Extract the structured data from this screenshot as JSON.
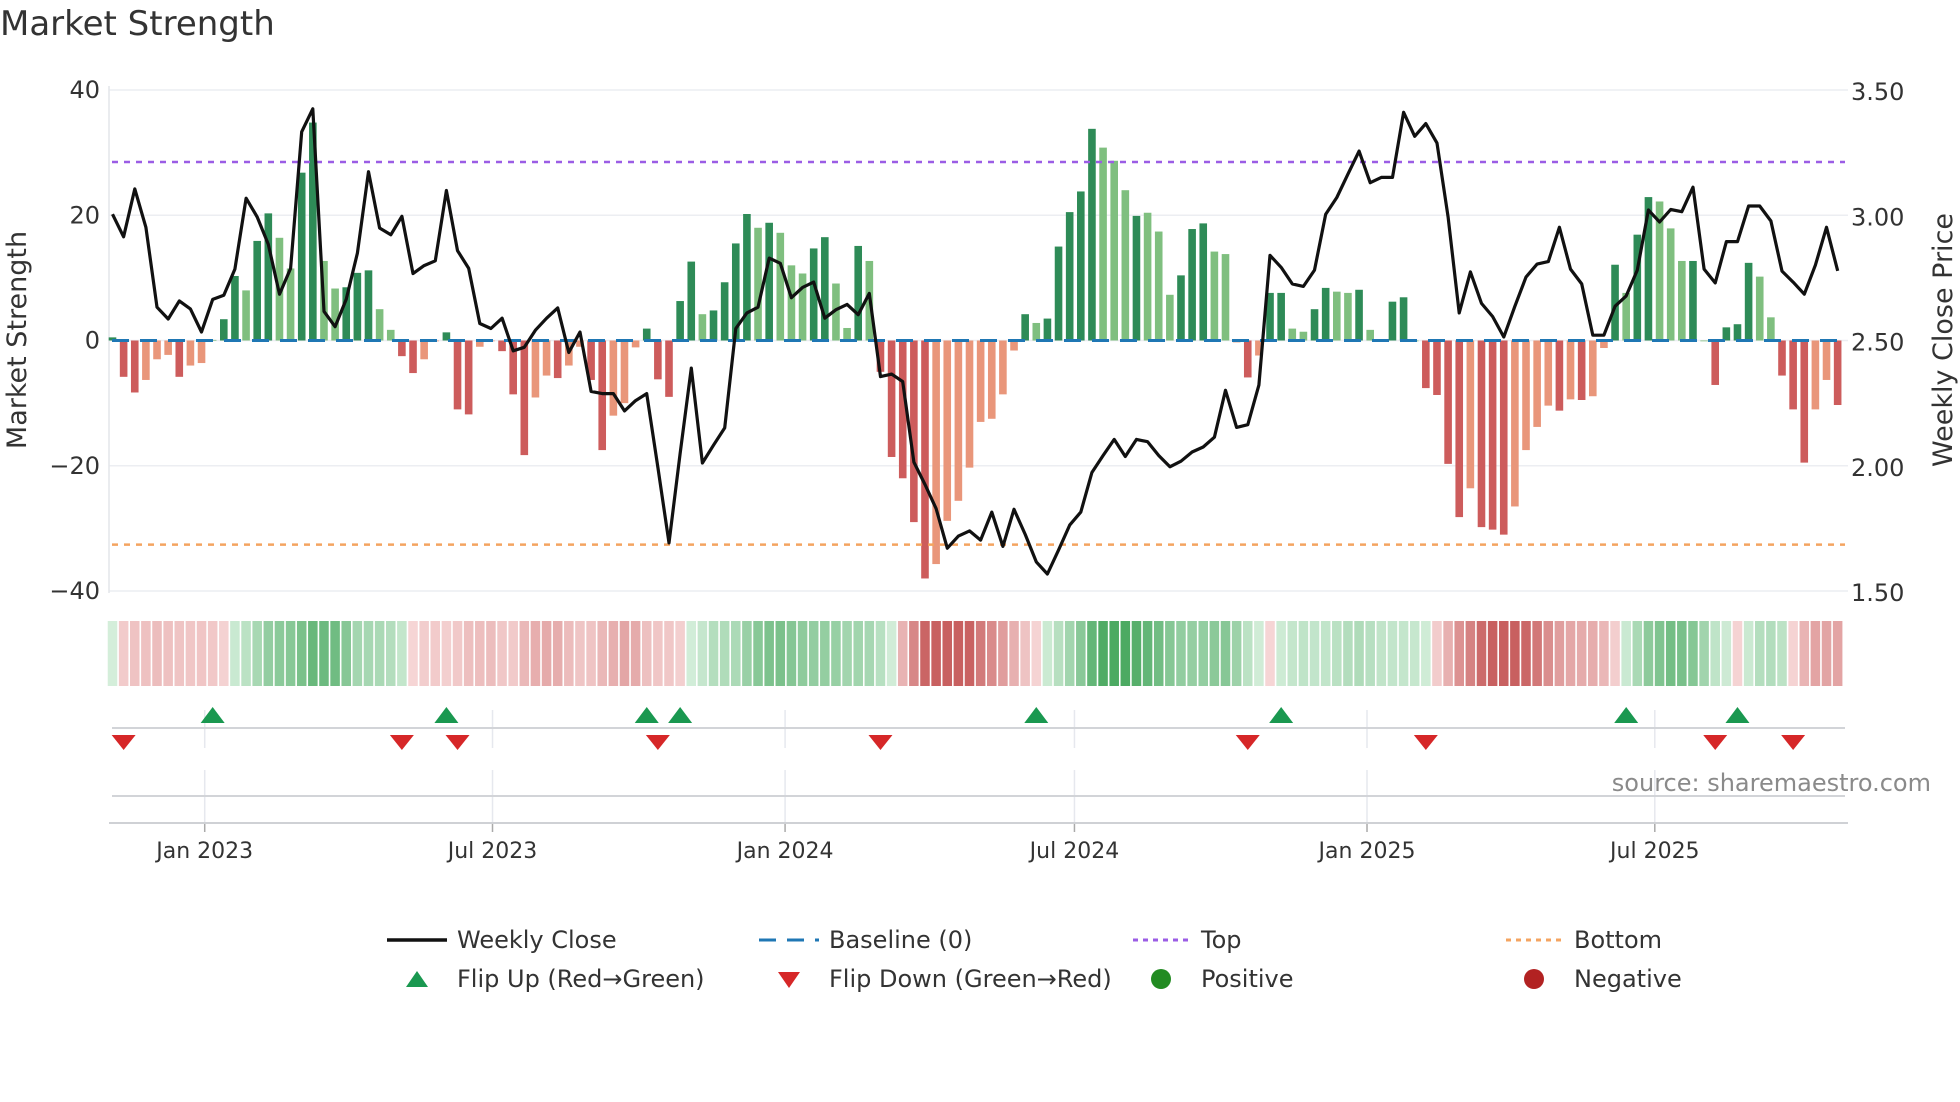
{
  "title": "Market Strength",
  "source": "source: sharemaestro.com",
  "legend": {
    "weekly_close": "Weekly Close",
    "baseline": "Baseline (0)",
    "top": "Top",
    "bottom": "Bottom",
    "flip_up": "Flip Up (Red→Green)",
    "flip_down": "Flip Down (Green→Red)",
    "positive": "Positive",
    "negative": "Negative"
  },
  "colors": {
    "strong_up": "#2e8b57",
    "weak_up": "#7fbf7f",
    "strong_down": "#cd5c5c",
    "weak_down": "#e9967a",
    "close_line": "#111111",
    "baseline": "#1f77b4",
    "top": "#9b5de5",
    "bottom": "#f4a460",
    "flip_up": "#1a9850",
    "flip_down": "#d62728",
    "positive": "#228b22",
    "negative": "#b22222"
  },
  "chart_data": {
    "type": "bar",
    "title": "Market Strength",
    "ylabel": "Market Strength",
    "ylabel_right": "Weekly Close Price",
    "ylim": [
      -40,
      40
    ],
    "ylim_right": [
      1.5,
      3.5
    ],
    "yticks": [
      "40",
      "20",
      "0",
      "−20",
      "−40"
    ],
    "yticks_right": [
      "3.50",
      "3.00",
      "2.50",
      "2.00",
      "1.50"
    ],
    "xticks": [
      {
        "label": "Jan 2023",
        "date": "2023-01-01"
      },
      {
        "label": "Jul 2023",
        "date": "2023-07-01"
      },
      {
        "label": "Jan 2024",
        "date": "2024-01-01"
      },
      {
        "label": "Jul 2024",
        "date": "2024-07-01"
      },
      {
        "label": "Jan 2025",
        "date": "2025-01-01"
      },
      {
        "label": "Jul 2025",
        "date": "2025-07-01"
      }
    ],
    "start_date": "2022-11-04",
    "frequency": "weekly",
    "top_level": 28.5,
    "bottom_level": -32.6,
    "baseline": 0,
    "strength": [
      0.5,
      -5.8,
      -8.3,
      -6.3,
      -3,
      -2.3,
      -5.8,
      -4,
      -3.6,
      0.1,
      3.4,
      10.3,
      8,
      15.9,
      20.3,
      16.4,
      11.5,
      26.8,
      34.8,
      12.7,
      8.3,
      8.5,
      10.8,
      11.2,
      5,
      1.7,
      -2.5,
      -5.2,
      -3,
      0,
      1.3,
      -11,
      -11.8,
      -1,
      0,
      -1.7,
      -8.6,
      -18.3,
      -9.1,
      -5.6,
      -6,
      -4,
      -1,
      -6.3,
      -17.5,
      -12,
      -10,
      -1.1,
      1.9,
      -6.2,
      -9,
      6.3,
      12.6,
      4.2,
      4.8,
      9.3,
      15.5,
      20.2,
      18,
      18.8,
      17.2,
      12,
      10.7,
      14.7,
      16.5,
      9.1,
      2,
      15.1,
      12.7,
      -5,
      -18.6,
      -22,
      -29,
      -38,
      -35.7,
      -28.8,
      -25.6,
      -20.3,
      -13,
      -12.5,
      -8.6,
      -1.6,
      4.2,
      2.8,
      3.5,
      15,
      20.5,
      23.8,
      33.8,
      30.8,
      28.7,
      24,
      19.9,
      20.4,
      17.4,
      7.3,
      10.4,
      17.8,
      18.7,
      14.2,
      13.8,
      -0.3,
      -5.9,
      -2.4,
      7.6,
      7.6,
      1.9,
      1.4,
      5,
      8.4,
      7.8,
      7.6,
      8.1,
      1.7,
      0,
      6.2,
      6.9,
      0,
      -7.6,
      -8.7,
      -19.7,
      -28.2,
      -23.6,
      -29.8,
      -30.2,
      -31,
      -26.5,
      -17.5,
      -13.8,
      -10.4,
      -11.2,
      -9.4,
      -9.5,
      -8.9,
      -1.2,
      12.1,
      7.6,
      16.9,
      22.9,
      22.2,
      17.9,
      12.7,
      12.7,
      0,
      -7.1,
      2.1,
      2.6,
      12.4,
      10.2,
      3.7,
      -5.6,
      -11,
      -19.5,
      -11,
      -6.3,
      -10.3
    ],
    "shade": "GRRrrrRrrgGGgGGggGGggGGGggRRrrGRRrrRRRrrRrrRRrrrGRRGGgGGGGgGgggGGggGgRRRRRrrrrrrrrGgGGGGGgggGgggGGGggrRrGGggGGggGggGGgRRRRrRRRrrrrRrRrrGgGGgggGgRGGGggRRRrrR",
    "weekly_close": [
      3.004,
      2.914,
      3.105,
      2.952,
      2.633,
      2.586,
      2.658,
      2.626,
      2.534,
      2.664,
      2.681,
      2.785,
      3.068,
      2.993,
      2.884,
      2.685,
      2.788,
      3.333,
      3.425,
      2.616,
      2.555,
      2.664,
      2.849,
      3.174,
      2.949,
      2.922,
      2.996,
      2.767,
      2.799,
      2.818,
      3.099,
      2.859,
      2.788,
      2.568,
      2.548,
      2.589,
      2.459,
      2.473,
      2.541,
      2.589,
      2.63,
      2.452,
      2.534,
      2.297,
      2.288,
      2.288,
      2.219,
      2.26,
      2.288,
      1.993,
      1.692,
      2.048,
      2.39,
      2.011,
      2.082,
      2.151,
      2.548,
      2.61,
      2.633,
      2.829,
      2.808,
      2.671,
      2.712,
      2.733,
      2.589,
      2.623,
      2.644,
      2.603,
      2.688,
      2.356,
      2.366,
      2.336,
      2.014,
      1.925,
      1.829,
      1.671,
      1.719,
      1.74,
      1.703,
      1.815,
      1.678,
      1.826,
      1.726,
      1.616,
      1.568,
      1.664,
      1.763,
      1.815,
      1.973,
      2.041,
      2.105,
      2.037,
      2.105,
      2.096,
      2.041,
      1.996,
      2.018,
      2.055,
      2.075,
      2.114,
      2.301,
      2.153,
      2.164,
      2.322,
      2.84,
      2.792,
      2.726,
      2.716,
      2.781,
      3.004,
      3.071,
      3.164,
      3.256,
      3.13,
      3.151,
      3.151,
      3.411,
      3.315,
      3.366,
      3.288,
      2.993,
      2.61,
      2.774,
      2.648,
      2.596,
      2.514,
      2.637,
      2.753,
      2.805,
      2.815,
      2.952,
      2.785,
      2.726,
      2.521,
      2.521,
      2.637,
      2.678,
      2.781,
      3.021,
      2.973,
      3.023,
      3.014,
      3.112,
      2.785,
      2.73,
      2.895,
      2.895,
      3.037,
      3.037,
      2.977,
      2.777,
      2.733,
      2.685,
      2.801,
      2.952,
      2.778
    ],
    "flips_up": [
      "2023-01-06",
      "2023-06-02",
      "2023-10-06",
      "2023-10-27",
      "2024-06-07",
      "2024-11-08",
      "2025-06-13",
      "2025-08-22"
    ],
    "flips_down": [
      "2022-11-11",
      "2023-05-05",
      "2023-06-09",
      "2023-10-13",
      "2024-03-01",
      "2024-10-18",
      "2025-02-07",
      "2025-08-08",
      "2025-09-26"
    ],
    "grid": true,
    "legend_position": "bottom"
  }
}
